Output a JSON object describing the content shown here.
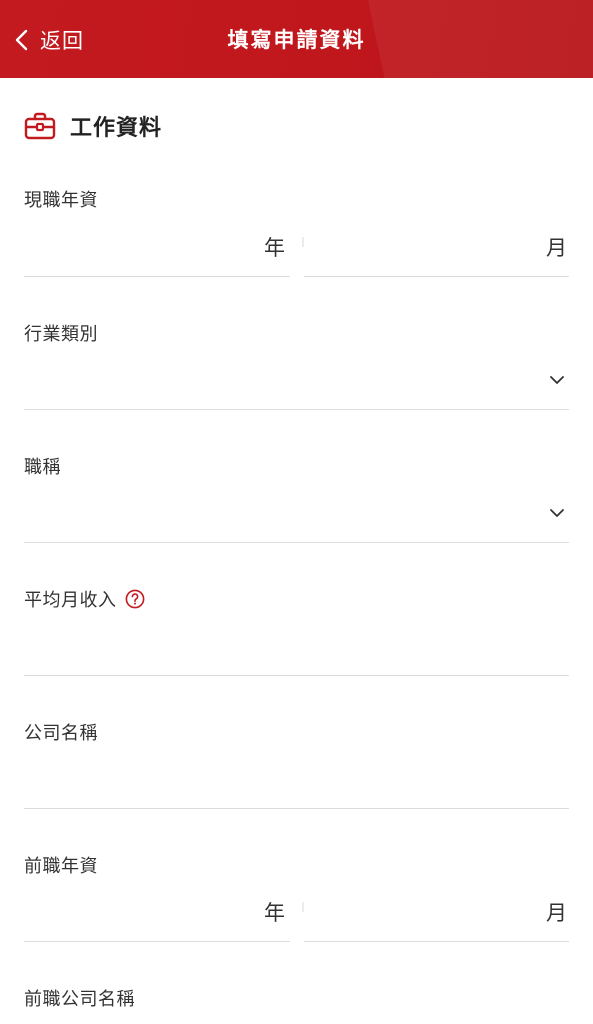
{
  "header": {
    "back_label": "返回",
    "title": "填寫申請資料"
  },
  "section": {
    "title": "工作資料",
    "icon": "briefcase-icon"
  },
  "fields": {
    "current_tenure": {
      "label": "現職年資",
      "year_unit": "年",
      "month_unit": "月"
    },
    "industry": {
      "label": "行業類別"
    },
    "job_title": {
      "label": "職稱"
    },
    "monthly_income": {
      "label": "平均月收入"
    },
    "company_name": {
      "label": "公司名稱"
    },
    "previous_tenure": {
      "label": "前職年資",
      "year_unit": "年",
      "month_unit": "月"
    },
    "previous_company": {
      "label": "前職公司名稱"
    }
  },
  "colors": {
    "accent": "#c31a1f",
    "divider": "#dcdcdc"
  }
}
